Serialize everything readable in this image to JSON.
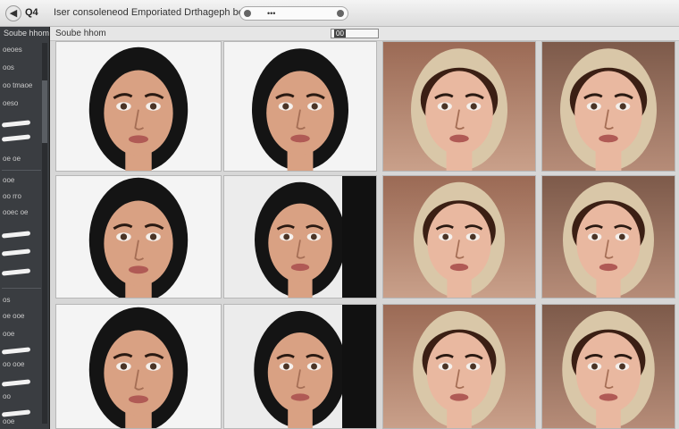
{
  "window": {
    "back_glyph": "◀",
    "app_label": "Q4",
    "page_title": "Iser consoleneod Emporiated Drthageph be dki",
    "address_text": "•••",
    "crumb": "Soube hhom",
    "zoom_value": "00"
  },
  "sidebar": {
    "title": "Soube hhom",
    "items": [
      "oeoes",
      "oos",
      "oo tmaoe",
      "oeso",
      "oe oe",
      "ooe",
      "oo rro",
      "ooec oe",
      "os",
      "oe ooe",
      "ooe",
      "oo ooe",
      "oo",
      "ooe"
    ]
  },
  "thumbnails": [
    {
      "id": "a1",
      "style": "light",
      "head": "dark"
    },
    {
      "id": "a2",
      "style": "light",
      "head": "dark"
    },
    {
      "id": "a3",
      "style": "warm",
      "head": "hood"
    },
    {
      "id": "a4",
      "style": "warm2",
      "head": "hood"
    },
    {
      "id": "b1",
      "style": "light",
      "head": "dark"
    },
    {
      "id": "b2",
      "style": "dark-edge",
      "head": "dark"
    },
    {
      "id": "b3",
      "style": "warm",
      "head": "hood"
    },
    {
      "id": "b4",
      "style": "warm2",
      "head": "hood"
    },
    {
      "id": "c1",
      "style": "light",
      "head": "dark"
    },
    {
      "id": "c2",
      "style": "dark-edge",
      "head": "dark"
    },
    {
      "id": "c3",
      "style": "warm",
      "head": "hood"
    },
    {
      "id": "c4",
      "style": "warm2",
      "head": "hood"
    }
  ],
  "colors": {
    "skin": "#d9a183",
    "skin_light": "#e9b8a0",
    "hair_dark": "#141414",
    "hood": "#d9c7a8",
    "sidebar_bg": "#3a3d41"
  }
}
